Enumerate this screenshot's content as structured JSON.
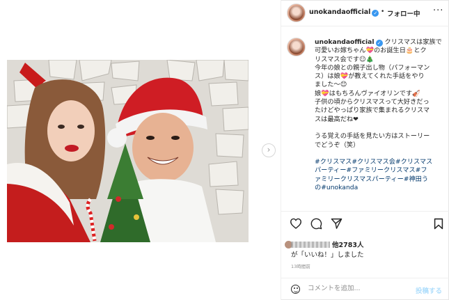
{
  "header": {
    "username": "unokandaofficial",
    "separator": "•",
    "follow_label": "フォロー中",
    "more_label": "···"
  },
  "caption": {
    "username": "unokandaofficial",
    "lines": [
      "クリスマスは家族で",
      "可愛いお嫁ちゃん💝のお誕生日🎂とク",
      "リスマス会です☺🎄",
      "今年の娘との親子出し物（パフォーマン",
      "ス）は娘💝が教えてくれた手話をやり",
      "ました〜😊",
      "娘💝はもちろんヴァイオリンです🎻",
      "子供の頃からクリスマスって大好きだっ",
      "たけどやっぱり家族で集まれるクリスマ",
      "スは最高だね❤"
    ],
    "lines2": [
      "うる覚えの手話を見たい方はストーリー",
      "でどうぞ（笑）"
    ],
    "hashtag_lines": [
      "#クリスマス#クリスマス会#クリスマス",
      "パーティー#ファミリークリスマス#フ",
      "ァミリークリスマスパーティー#神田う",
      "の#unokanda"
    ]
  },
  "likes": {
    "count_text": "他2783人",
    "suffix": "が「いいね！」しました",
    "timestamp": "13時間前"
  },
  "comment": {
    "placeholder": "コメントを追加...",
    "post_label": "投稿する"
  },
  "media": {
    "next_label": "›"
  },
  "colors": {
    "link": "#00376b",
    "verified": "#3897f0",
    "post_disabled": "#b2dffc",
    "muted": "#8e8e8e"
  },
  "icons": [
    "heart-icon",
    "comment-icon",
    "share-icon",
    "bookmark-icon",
    "emoji-icon",
    "verified-badge-icon",
    "more-options-icon",
    "carousel-next-icon"
  ]
}
